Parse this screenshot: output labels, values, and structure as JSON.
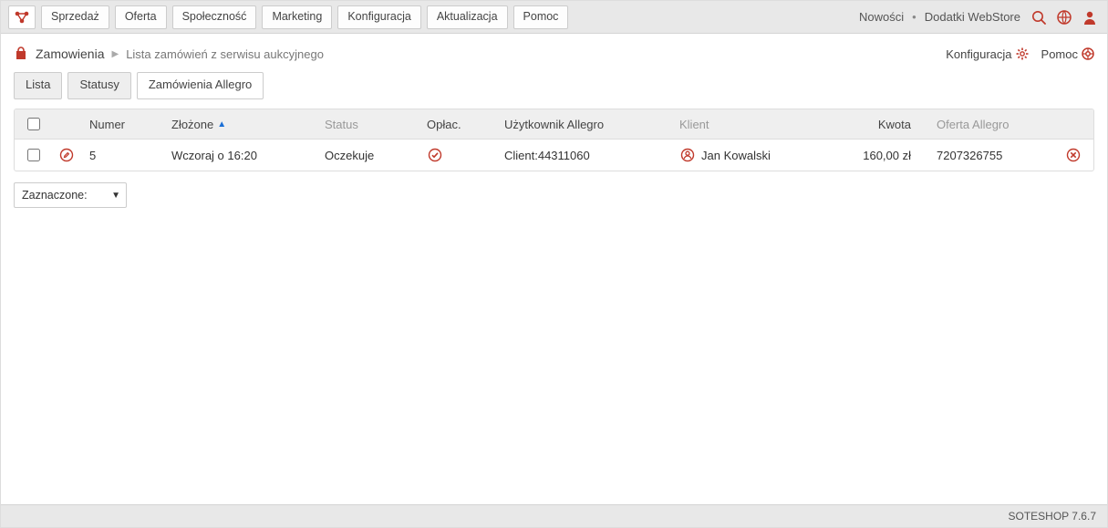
{
  "topbar": {
    "nav": [
      "Sprzedaż",
      "Oferta",
      "Społeczność",
      "Marketing",
      "Konfiguracja",
      "Aktualizacja",
      "Pomoc"
    ],
    "link_news": "Nowości",
    "link_addons": "Dodatki WebStore"
  },
  "breadcrumb": {
    "main": "Zamowienia",
    "sub": "Lista zamówień z serwisu aukcyjnego",
    "action_config": "Konfiguracja",
    "action_help": "Pomoc"
  },
  "tabs": {
    "list": "Lista",
    "statuses": "Statusy",
    "allegro": "Zamówienia Allegro"
  },
  "table": {
    "headers": {
      "number": "Numer",
      "placed": "Złożone",
      "status": "Status",
      "paid": "Opłac.",
      "allegro_user": "Użytkownik Allegro",
      "client": "Klient",
      "amount": "Kwota",
      "offer": "Oferta Allegro"
    },
    "rows": [
      {
        "number": "5",
        "placed": "Wczoraj o 16:20",
        "status": "Oczekuje",
        "allegro_user": "Client:44311060",
        "client": "Jan Kowalski",
        "amount": "160,00 zł",
        "offer": "7207326755"
      }
    ]
  },
  "bulk": {
    "label": "Zaznaczone:"
  },
  "footer": {
    "text": "SOTESHOP 7.6.7"
  }
}
